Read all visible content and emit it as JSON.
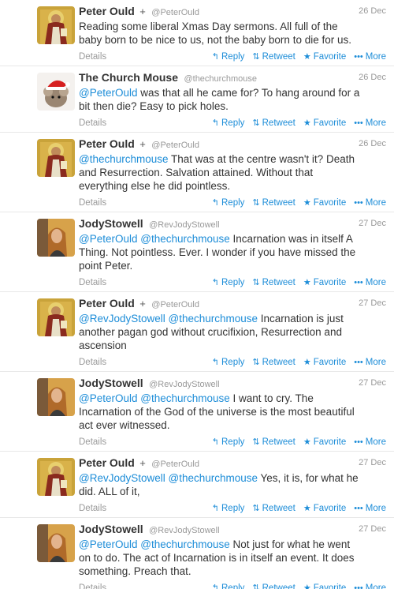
{
  "labels": {
    "details": "Details",
    "reply": "Reply",
    "retweet": "Retweet",
    "favorite": "Favorite",
    "more": "More"
  },
  "icons": {
    "reply": "reply-arrow-icon",
    "retweet": "retweet-arrows-icon",
    "favorite": "star-icon",
    "more": "ellipsis-icon",
    "verified_mark": "cross-icon"
  },
  "colors": {
    "link": "#1d8dd8",
    "meta": "#999999",
    "text": "#333333"
  },
  "tweets": [
    {
      "name": "Peter Ould",
      "mark": "+",
      "handle": "@PeterOuld",
      "date": "26 Dec",
      "parts": [
        {
          "t": "Reading some liberal Xmas Day sermons. All full of the baby born to be nice to us, not the baby born to die for us."
        }
      ]
    },
    {
      "name": "The Church Mouse",
      "mark": "",
      "handle": "@thechurchmouse",
      "date": "26 Dec",
      "parts": [
        {
          "t": "@PeterOuld",
          "m": true
        },
        {
          "t": " was that all he came for? To hang around for a bit then die? Easy to pick holes."
        }
      ]
    },
    {
      "name": "Peter Ould",
      "mark": "+",
      "handle": "@PeterOuld",
      "date": "26 Dec",
      "parts": [
        {
          "t": "@thechurchmouse",
          "m": true
        },
        {
          "t": " That was at the centre wasn't it? Death and Resurrection. Salvation attained. Without that everything else he did pointless."
        }
      ]
    },
    {
      "name": "JodyStowell",
      "mark": "",
      "handle": "@RevJodyStowell",
      "date": "27 Dec",
      "parts": [
        {
          "t": "@PeterOuld",
          "m": true
        },
        {
          "t": " "
        },
        {
          "t": "@thechurchmouse",
          "m": true
        },
        {
          "t": "  Incarnation was in itself A Thing. Not pointless. Ever. I wonder if you have missed the point Peter."
        }
      ]
    },
    {
      "name": "Peter Ould",
      "mark": "+",
      "handle": "@PeterOuld",
      "date": "27 Dec",
      "parts": [
        {
          "t": "@RevJodyStowell",
          "m": true
        },
        {
          "t": " "
        },
        {
          "t": "@thechurchmouse",
          "m": true
        },
        {
          "t": " Incarnation is just another pagan god without crucifixion, Resurrection and ascension"
        }
      ]
    },
    {
      "name": "JodyStowell",
      "mark": "",
      "handle": "@RevJodyStowell",
      "date": "27 Dec",
      "parts": [
        {
          "t": "@PeterOuld",
          "m": true
        },
        {
          "t": " "
        },
        {
          "t": "@thechurchmouse",
          "m": true
        },
        {
          "t": " I want to cry. The Incarnation of the God of the universe is the most beautiful act ever witnessed."
        }
      ]
    },
    {
      "name": "Peter Ould",
      "mark": "+",
      "handle": "@PeterOuld",
      "date": "27 Dec",
      "parts": [
        {
          "t": "@RevJodyStowell",
          "m": true
        },
        {
          "t": " "
        },
        {
          "t": "@thechurchmouse",
          "m": true
        },
        {
          "t": " Yes, it is, for what he did. ALL of it,"
        }
      ]
    },
    {
      "name": "JodyStowell",
      "mark": "",
      "handle": "@RevJodyStowell",
      "date": "27 Dec",
      "parts": [
        {
          "t": "@PeterOuld",
          "m": true
        },
        {
          "t": " "
        },
        {
          "t": "@thechurchmouse",
          "m": true
        },
        {
          "t": " Not just for what he went on to do. The act of Incarnation is in itself an event. It does something. Preach that."
        }
      ]
    }
  ]
}
